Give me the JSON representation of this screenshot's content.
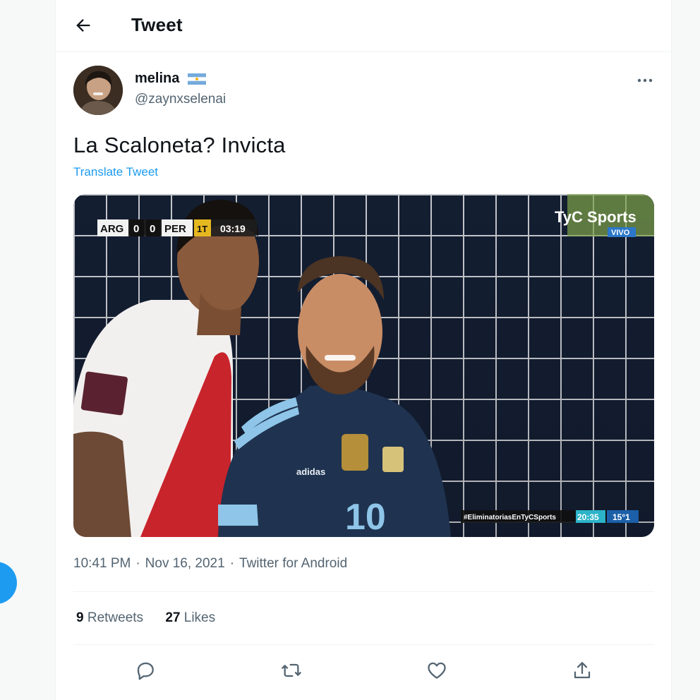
{
  "header": {
    "title": "Tweet",
    "back_icon": "arrow-left-icon"
  },
  "tweet": {
    "author": {
      "display_name": "melina",
      "handle": "@zaynxselenai",
      "flag_icon": "argentina-flag-icon"
    },
    "text": "La Scaloneta? Invicta",
    "translate_label": "Translate Tweet",
    "media": {
      "scoreboard": {
        "home": "ARG",
        "home_score": "0",
        "away_score": "0",
        "away": "PER",
        "period": "1T",
        "clock": "03:19"
      },
      "broadcaster": "TyC Sports",
      "live_badge": "VIVO",
      "hashtag_bar": {
        "hashtag": "#EliminatoriasEnTyCSports",
        "time": "20:35",
        "temp": "15°1"
      },
      "jersey_number": "10"
    },
    "time": "10:41 PM",
    "date": "Nov 16, 2021",
    "source": "Twitter for Android",
    "retweets": {
      "count": "9",
      "label": "Retweets"
    },
    "likes": {
      "count": "27",
      "label": "Likes"
    }
  },
  "colors": {
    "accent": "#1d9bf0",
    "secondary_text": "#536471",
    "border": "#eff3f4"
  },
  "actions": [
    "reply-icon",
    "retweet-icon",
    "like-icon",
    "share-icon"
  ]
}
